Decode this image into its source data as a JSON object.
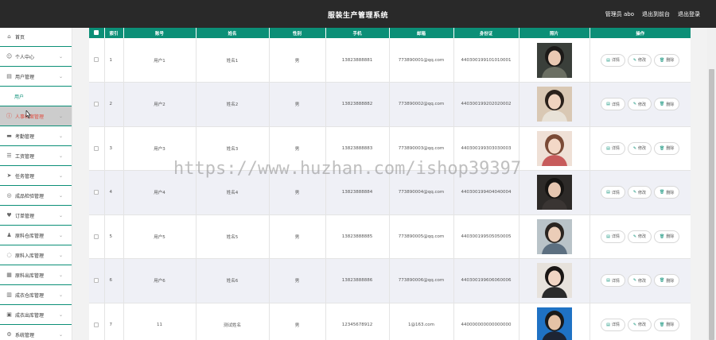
{
  "app": {
    "title": "服装生产管理系统",
    "user_label": "管理员 abo",
    "back_label": "退出到前台",
    "logout_label": "退出登录"
  },
  "sidebar": {
    "items": [
      {
        "label": "首页",
        "icon": "home-icon",
        "chevron": false
      },
      {
        "label": "个人中心",
        "icon": "person-icon",
        "chevron": true
      },
      {
        "label": "用户管理",
        "icon": "users-icon",
        "chevron": true
      },
      {
        "label": "用户",
        "icon": "",
        "sub": true
      },
      {
        "label": "人事档案管理",
        "icon": "archive-icon",
        "chevron": true,
        "active": true
      },
      {
        "label": "考勤管理",
        "icon": "attendance-icon",
        "chevron": true
      },
      {
        "label": "工资管理",
        "icon": "salary-icon",
        "chevron": true
      },
      {
        "label": "任务管理",
        "icon": "task-icon",
        "chevron": true
      },
      {
        "label": "成品检验管理",
        "icon": "inspect-icon",
        "chevron": true
      },
      {
        "label": "订单管理",
        "icon": "order-icon",
        "chevron": true
      },
      {
        "label": "原料仓库管理",
        "icon": "warehouse-icon",
        "chevron": true
      },
      {
        "label": "原料入库管理",
        "icon": "inbound-icon",
        "chevron": true
      },
      {
        "label": "原料出库管理",
        "icon": "outbound-icon",
        "chevron": true
      },
      {
        "label": "成衣仓库管理",
        "icon": "garment-icon",
        "chevron": true
      },
      {
        "label": "成衣出库管理",
        "icon": "ship-icon",
        "chevron": true
      },
      {
        "label": "系统管理",
        "icon": "settings-icon",
        "chevron": true
      }
    ]
  },
  "table": {
    "headers": [
      "索引",
      "账号",
      "姓名",
      "性别",
      "手机",
      "邮箱",
      "身份证",
      "照片",
      "操作"
    ],
    "rows": [
      {
        "index": "1",
        "account": "用户1",
        "name": "姓名1",
        "gender": "男",
        "phone": "13823888881",
        "email": "773890001@qq.com",
        "id_card": "440300199101010001"
      },
      {
        "index": "2",
        "account": "用户2",
        "name": "姓名2",
        "gender": "男",
        "phone": "13823888882",
        "email": "773890002@qq.com",
        "id_card": "440300199202020002"
      },
      {
        "index": "3",
        "account": "用户3",
        "name": "姓名3",
        "gender": "男",
        "phone": "13823888883",
        "email": "773890003@qq.com",
        "id_card": "440300199303030003"
      },
      {
        "index": "4",
        "account": "用户4",
        "name": "姓名4",
        "gender": "男",
        "phone": "13823888884",
        "email": "773890004@qq.com",
        "id_card": "440300199404040004"
      },
      {
        "index": "5",
        "account": "用户5",
        "name": "姓名5",
        "gender": "男",
        "phone": "13823888885",
        "email": "773890005@qq.com",
        "id_card": "440300199505050005"
      },
      {
        "index": "6",
        "account": "用户6",
        "name": "姓名6",
        "gender": "男",
        "phone": "13823888886",
        "email": "773890006@qq.com",
        "id_card": "440300199606060006"
      },
      {
        "index": "7",
        "account": "11",
        "name": "测试姓名",
        "gender": "男",
        "phone": "12345678912",
        "email": "1@163.com",
        "id_card": "440000000000000000"
      }
    ],
    "actions": {
      "detail": "详情",
      "edit": "修改",
      "delete": "删除"
    }
  },
  "watermark": "https://www.huzhan.com/ishop39397",
  "colors": {
    "accent": "#0b8f77",
    "topbar": "#292929",
    "active_text": "#e04c3f"
  }
}
